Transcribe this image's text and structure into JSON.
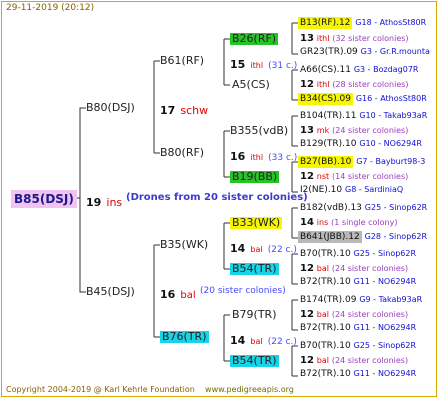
{
  "header": {
    "date": "29-11-2019 (20:12)"
  },
  "footer": {
    "copyright": "Copyright 2004-2019 @ Karl Kehrle Foundation",
    "site": "www.pedigreeapis.org"
  },
  "root": {
    "name": "B85(DSJ)",
    "gen_num": "19",
    "gen_abbr": "ins",
    "note": "(Drones from 20 sister colonies)"
  },
  "gen1": [
    {
      "name": "B80(DSJ)",
      "gen_num": "17",
      "gen_abbr": "schw"
    },
    {
      "name": "B45(DSJ)",
      "gen_num": "16",
      "gen_abbr": "bal",
      "note": "(20 sister colonies)"
    }
  ],
  "gen2": [
    {
      "name": "B61(RF)",
      "gen_num": "15",
      "gen_abbr": "ithl",
      "note": "(31 c.)"
    },
    {
      "name": "B80(RF)",
      "gen_num": "16",
      "gen_abbr": "ithl",
      "note": "(33 c.)"
    },
    {
      "name": "B35(WK)",
      "gen_num": "14",
      "gen_abbr": "bal",
      "note": "(22 c.)"
    },
    {
      "name": "B76(TR)",
      "gen_num": "14",
      "gen_abbr": "bal",
      "note": "(22 c.)"
    }
  ],
  "gen3": [
    {
      "name": "B26(RF)"
    },
    {
      "name": "A5(CS)"
    },
    {
      "name": "B355(vdB)"
    },
    {
      "name": "B19(BB)"
    },
    {
      "name": "B33(WK)"
    },
    {
      "name": "B54(TR)"
    },
    {
      "name": "B79(TR)"
    },
    {
      "name": "B54(TR)"
    }
  ],
  "rows": [
    {
      "text": "B13(RF).12",
      "code": "G18 - AthosSt80R"
    },
    {
      "num": "13",
      "abbr": "ithl",
      "note": "(32 sister colonies)"
    },
    {
      "text": "GR23(TR).09",
      "code": "G3 - Gr.R.mounta"
    },
    {
      "text": "A66(CS).11",
      "code": "G3 - Bozdag07R"
    },
    {
      "num": "12",
      "abbr": "ithl",
      "note": "(28 sister colonies)"
    },
    {
      "text": "B34(CS).09",
      "code": "G16 - AthosSt80R"
    },
    {
      "text": "B104(TR).11",
      "code": "G10 - Takab93aR"
    },
    {
      "num": "13",
      "abbr": "mk",
      "note": "(24 sister colonies)"
    },
    {
      "text": "B129(TR).10",
      "code": "G10 - NO6294R"
    },
    {
      "text": "B27(BB).10",
      "code": "G7 - Bayburt98-3"
    },
    {
      "num": "12",
      "abbr": "nst",
      "note": "(14 sister colonies)"
    },
    {
      "text": "I2(NE).10",
      "code": "G8 - SardiniaQ"
    },
    {
      "text": "B182(vdB).13",
      "code": "G25 - Sinop62R"
    },
    {
      "num": "14",
      "abbr": "ins",
      "note": "(1 single colony)"
    },
    {
      "text": "B641(JBB).12",
      "code": "G28 - Sinop62R"
    },
    {
      "text": "B70(TR).10",
      "code": "G25 - Sinop62R"
    },
    {
      "num": "12",
      "abbr": "bal",
      "note": "(24 sister colonies)"
    },
    {
      "text": "B72(TR).10",
      "code": "G11 - NO6294R"
    },
    {
      "text": "B174(TR).09",
      "code": "G9 - Takab93aR"
    },
    {
      "num": "12",
      "abbr": "bal",
      "note": "(24 sister colonies)"
    },
    {
      "text": "B72(TR).10",
      "code": "G11 - NO6294R"
    },
    {
      "text": "B70(TR).10",
      "code": "G25 - Sinop62R"
    },
    {
      "num": "12",
      "abbr": "bal",
      "note": "(24 sister colonies)"
    },
    {
      "text": "B72(TR).10",
      "code": "G11 - NO6294R"
    }
  ],
  "colors": {
    "green": "#27c427",
    "yellow": "#f6f600",
    "cyan": "#17d4e8",
    "gray": "#b8b8b8",
    "pink": "#f1c3f1"
  }
}
